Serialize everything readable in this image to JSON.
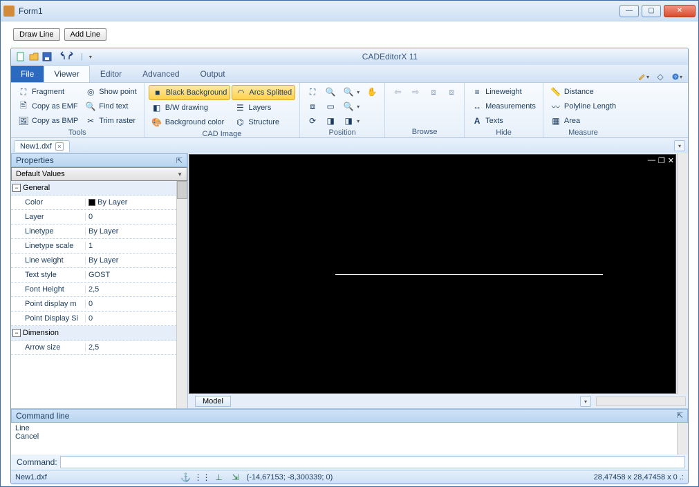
{
  "window": {
    "title": "Form1"
  },
  "buttons": {
    "draw_line": "Draw Line",
    "add_line": "Add Line"
  },
  "app_title": "CADEditorX 11",
  "tabs": {
    "file": "File",
    "viewer": "Viewer",
    "editor": "Editor",
    "advanced": "Advanced",
    "output": "Output"
  },
  "ribbon": {
    "tools": {
      "label": "Tools",
      "fragment": "Fragment",
      "copy_emf": "Copy as EMF",
      "copy_bmp": "Copy as BMP",
      "show_point": "Show point",
      "find_text": "Find text",
      "trim_raster": "Trim raster"
    },
    "cad_image": {
      "label": "CAD Image",
      "black_bg": "Black Background",
      "bw": "B/W drawing",
      "bg_color": "Background color",
      "arcs": "Arcs Splitted",
      "layers": "Layers",
      "structure": "Structure"
    },
    "position": {
      "label": "Position"
    },
    "browse": {
      "label": "Browse"
    },
    "hide": {
      "label": "Hide",
      "lineweight": "Lineweight",
      "measurements": "Measurements",
      "texts": "Texts"
    },
    "measure": {
      "label": "Measure",
      "distance": "Distance",
      "polyline": "Polyline Length",
      "area": "Area"
    }
  },
  "document": {
    "tab": "New1.dxf"
  },
  "properties": {
    "title": "Properties",
    "selector": "Default Values",
    "groups": {
      "general": "General",
      "dimension": "Dimension"
    },
    "rows": {
      "color": {
        "name": "Color",
        "val": "By Layer"
      },
      "layer": {
        "name": "Layer",
        "val": "0"
      },
      "linetype": {
        "name": "Linetype",
        "val": "By Layer"
      },
      "linetype_scale": {
        "name": "Linetype scale",
        "val": "1"
      },
      "line_weight": {
        "name": "Line weight",
        "val": "By Layer"
      },
      "text_style": {
        "name": "Text style",
        "val": "GOST"
      },
      "font_height": {
        "name": "Font Height",
        "val": "2,5"
      },
      "point_mode": {
        "name": "Point display m",
        "val": "0"
      },
      "point_size": {
        "name": "Point Display Si",
        "val": "0"
      },
      "arrow_size": {
        "name": "Arrow size",
        "val": "2,5"
      }
    }
  },
  "canvas": {
    "model_tab": "Model"
  },
  "command": {
    "title": "Command line",
    "log1": "Line",
    "log2": "Cancel",
    "prompt": "Command:"
  },
  "status": {
    "file": "New1.dxf",
    "coords": "(-14,67153; -8,300339; 0)",
    "dims": "28,47458 x 28,47458 x 0 .:"
  }
}
